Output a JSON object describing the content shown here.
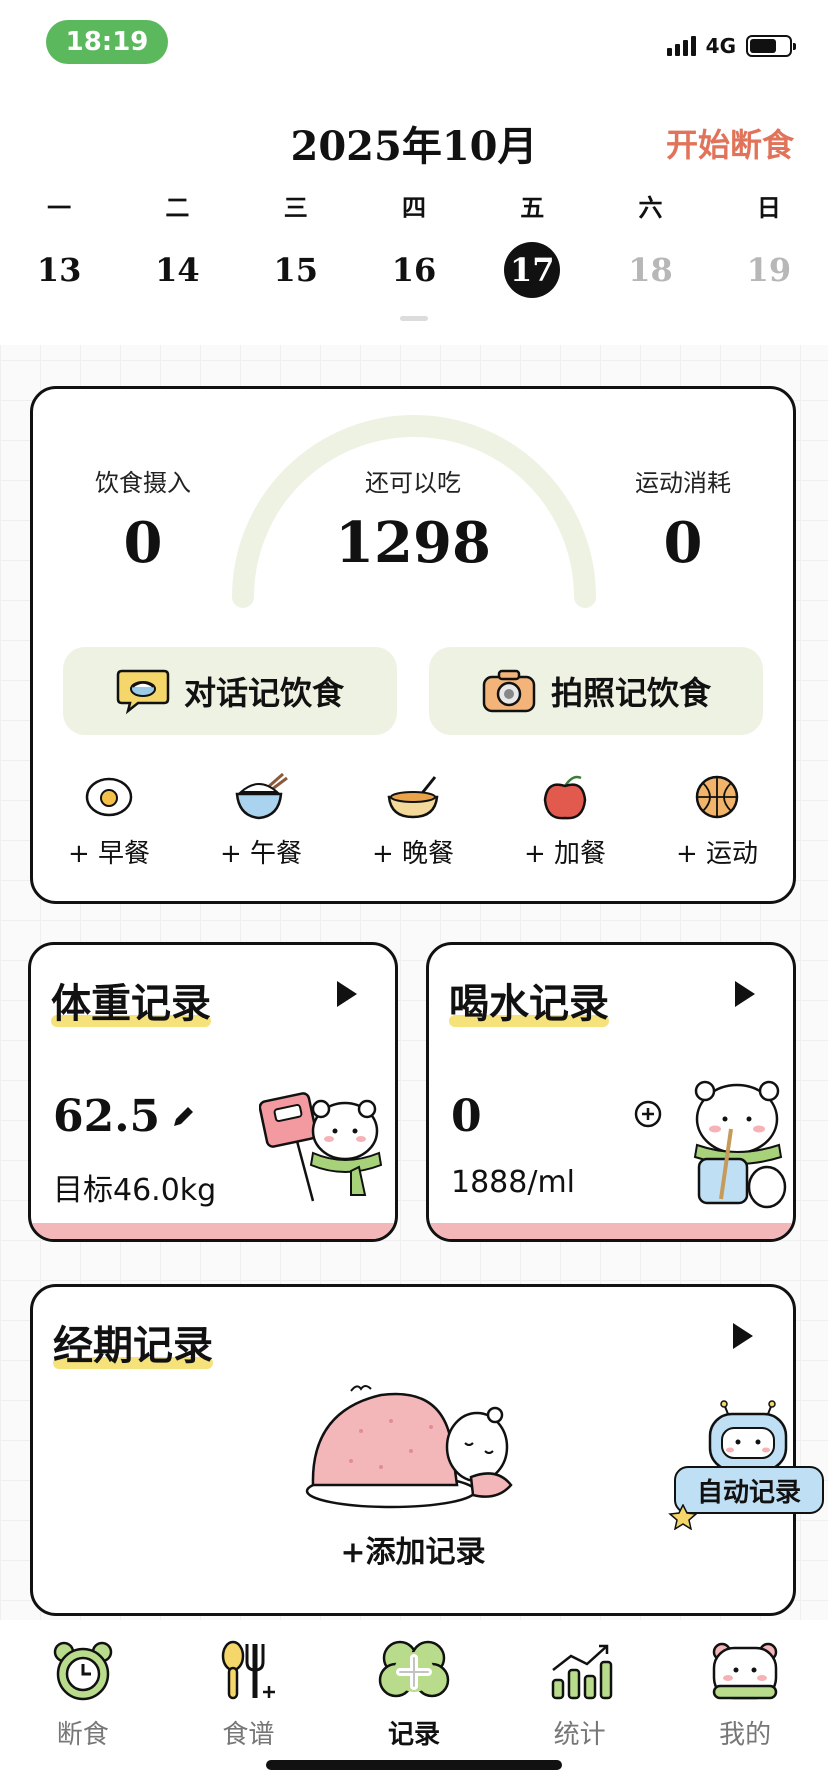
{
  "status_bar": {
    "time": "18:19",
    "network": "4G"
  },
  "header": {
    "month_title": "2025年10月",
    "start_fasting": "开始断食"
  },
  "week": {
    "weekdays": [
      "一",
      "二",
      "三",
      "四",
      "五",
      "六",
      "日"
    ],
    "days": [
      "13",
      "14",
      "15",
      "16",
      "17",
      "18",
      "19"
    ],
    "selected_index": 4
  },
  "calorie_card": {
    "intake_label": "饮食摄入",
    "intake_value": "0",
    "remaining_label": "还可以吃",
    "remaining_value": "1298",
    "burn_label": "运动消耗",
    "burn_value": "0",
    "chat_record": "对话记饮食",
    "photo_record": "拍照记饮食",
    "meals": [
      "+ 早餐",
      "+ 午餐",
      "+ 晚餐",
      "+ 加餐",
      "+ 运动"
    ]
  },
  "weight_card": {
    "title": "体重记录",
    "value": "62.5",
    "target": "目标46.0kg"
  },
  "water_card": {
    "title": "喝水记录",
    "value": "0",
    "goal": "1888/ml"
  },
  "period_card": {
    "title": "经期记录",
    "add_label": "+添加记录"
  },
  "auto_record": "自动记录",
  "bottom_nav": [
    {
      "label": "断食",
      "icon": "alarm-clock-icon"
    },
    {
      "label": "食谱",
      "icon": "spoon-fork-icon"
    },
    {
      "label": "记录",
      "icon": "plus-flower-icon"
    },
    {
      "label": "统计",
      "icon": "bar-chart-icon"
    },
    {
      "label": "我的",
      "icon": "bear-face-icon"
    }
  ],
  "colors": {
    "accent_green": "#5bb85d",
    "start_fast_orange": "#e0735a",
    "button_bg": "#eef2e2",
    "highlight_yellow": "#f6e27a",
    "card_pink": "#f4b7b9"
  }
}
